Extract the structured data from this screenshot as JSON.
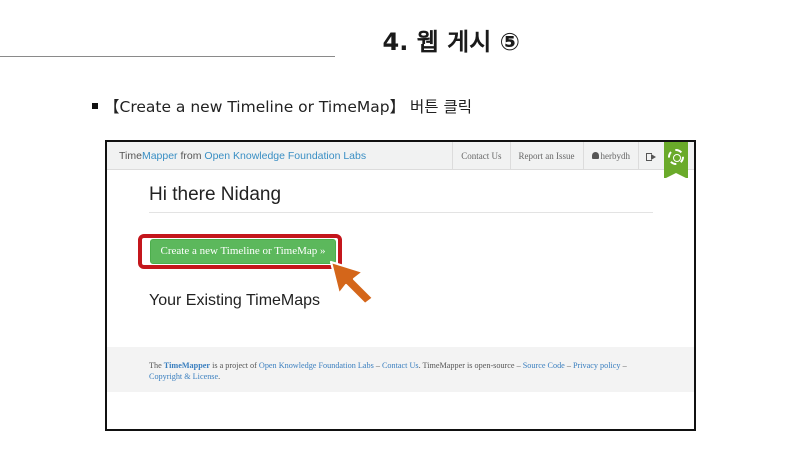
{
  "slide": {
    "title": "4. 웹 게시 ⑤",
    "instruction": "【Create a new Timeline or TimeMap】 버튼 클릭"
  },
  "navbar": {
    "brand_time": "Time",
    "brand_mapper": "Mapper",
    "brand_from": " from ",
    "brand_org": "Open Knowledge Foundation Labs",
    "links": {
      "contact": "Contact Us",
      "report": "Report an Issue",
      "user": "herbydh"
    },
    "icons": {
      "logout": "sign-out-icon",
      "ribbon": "gear-icon"
    }
  },
  "main": {
    "greeting": "Hi there Nidang",
    "create_button": "Create a new Timeline or TimeMap »",
    "existing_heading": "Your Existing TimeMaps"
  },
  "footer": {
    "p1": "The ",
    "timemapper": "TimeMapper",
    "p2": " is a project of ",
    "okfn": "Open Knowledge Foundation Labs",
    "p3": " – ",
    "contact": "Contact Us",
    "p4": ". TimeMapper is open-source – ",
    "source": "Source Code",
    "p5": " – ",
    "privacy": "Privacy policy",
    "p6": " – ",
    "license": "Copyright & License",
    "p7": "."
  },
  "colors": {
    "brand_blue": "#3a8fc4",
    "button_green": "#5cb85c",
    "highlight_red": "#c4161c",
    "arrow_orange": "#d4661a",
    "ribbon_green": "#6aaa2a"
  }
}
